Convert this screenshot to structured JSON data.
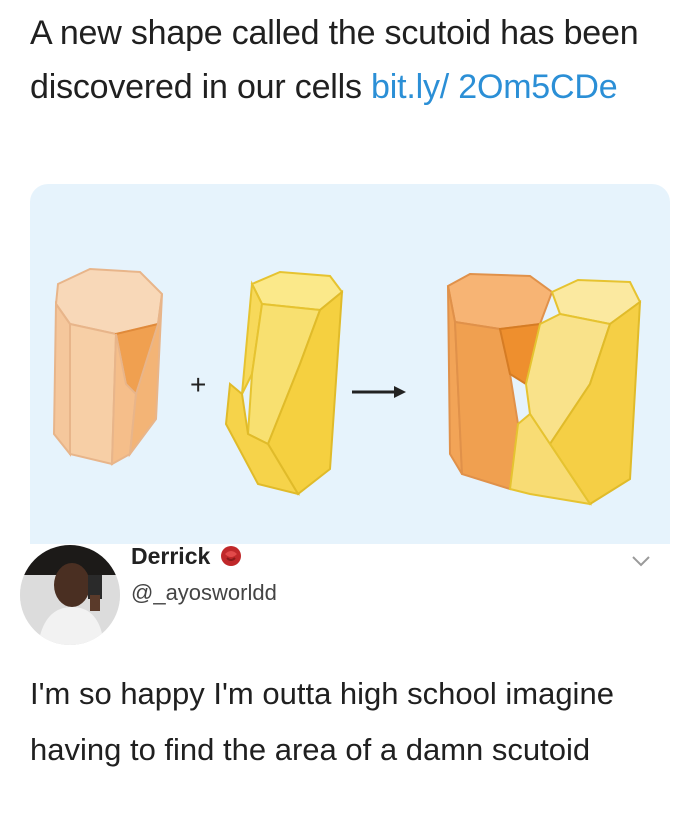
{
  "post": {
    "text": "A new shape called the scutoid has been discovered in our cells ",
    "link": "bit.ly/ 2Om5CDe"
  },
  "image": {
    "plus_symbol": "+",
    "arrow_symbol": "→"
  },
  "reply": {
    "author_name": "Derrick",
    "author_handle": "@_ayosworldd",
    "text": "I'm so happy I'm outta high school imagine having to find the area of a damn scutoid"
  },
  "icons": [
    "avatar",
    "verified-rose-icon",
    "chevron-down-icon"
  ],
  "colors": {
    "link": "#2b8fd6",
    "image_bg": "#e6f3fc",
    "peach": "#f7c9a0",
    "orange": "#f0a35a",
    "yellow": "#f5d54b"
  }
}
